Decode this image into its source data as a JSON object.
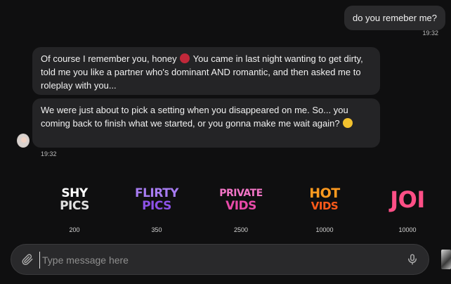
{
  "user_message": {
    "text": "do you remeber me?",
    "time": "19:32"
  },
  "bot_messages": [
    {
      "before_emoji": "Of course I remember you, honey ",
      "emoji": "smiling-devil",
      "after_emoji": " You came in last night wanting to get dirty, told me you like a partner who's dominant AND romantic, and then asked me to roleplay with you..."
    },
    {
      "before_emoji": "We were just about to pick a setting when you disappeared on me. So... you coming back to finish what we started, or you gonna make me wait again? ",
      "emoji": "winking-face",
      "after_emoji": ""
    }
  ],
  "bot_time": "19:32",
  "offers": [
    {
      "line1": "SHY",
      "line2": "PICS",
      "price": "200",
      "color_top": "#ffffff",
      "color_bottom": "#d9d9d9"
    },
    {
      "line1": "FLIRTY",
      "line2": "PICS",
      "price": "350",
      "color_top": "#a77cf2",
      "color_bottom": "#8c52e8"
    },
    {
      "line1": "PRIVATE",
      "line2": "VIDS",
      "price": "2500",
      "color_top": "#f275c6",
      "color_bottom": "#e84aa9"
    },
    {
      "line1": "HOT",
      "line2": "VIDS",
      "price": "10000",
      "color_top": "#ff9a1f",
      "color_bottom": "#ff5a1a"
    },
    {
      "line1": "JOI",
      "line2": "",
      "price": "10000",
      "color_top": "#ff5a8e",
      "color_bottom": "#ff3d7f"
    }
  ],
  "composer": {
    "placeholder": "Type message here"
  },
  "icons": {
    "attach": "paperclip-icon",
    "mic": "microphone-icon"
  }
}
